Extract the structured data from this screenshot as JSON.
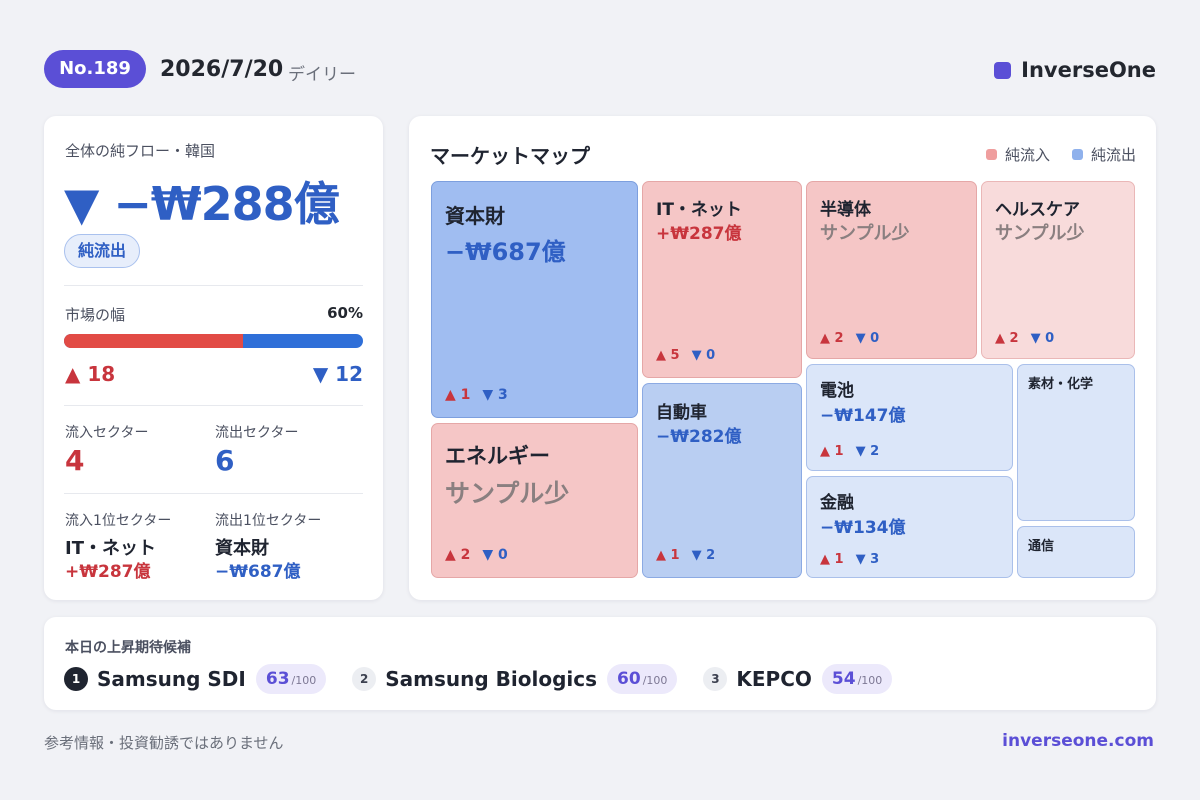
{
  "header": {
    "issue": "No.189",
    "date": "2026/7/20",
    "frequency": "デイリー",
    "brand": "InverseOne"
  },
  "colors": {
    "brand": "#5b4fd6",
    "inflow": "#f5c6c6",
    "outflow": "#a0bdf1",
    "up": "#c8353d",
    "down": "#2f5fc4"
  },
  "summary": {
    "label": "全体の純フロー・韓国",
    "total": "▼ −₩288億",
    "tag": "純流出",
    "breadth_label": "市場の幅",
    "breadth_pct": "60%",
    "breadth_up_fraction": 0.6,
    "advancers": "▲ 18",
    "decliners": "▼ 12",
    "inflow_sectors_label": "流入セクター",
    "inflow_sectors": "4",
    "outflow_sectors_label": "流出セクター",
    "outflow_sectors": "6",
    "top_inflow_label": "流入1位セクター",
    "top_inflow_name": "IT・ネット",
    "top_inflow_amount": "+₩287億",
    "top_outflow_label": "流出1位セクター",
    "top_outflow_name": "資本財",
    "top_outflow_amount": "−₩687億"
  },
  "market_map": {
    "title": "マーケットマップ",
    "legend_inflow": "純流入",
    "legend_outflow": "純流出",
    "tiles": {
      "capital_goods": {
        "name": "資本財",
        "amount": "−₩687億",
        "up": "▲ 1",
        "down": "▼ 3"
      },
      "energy": {
        "name": "エネルギー",
        "amount": "サンプル少",
        "up": "▲ 2",
        "down": "▼ 0"
      },
      "it_net": {
        "name": "IT・ネット",
        "amount": "+₩287億",
        "up": "▲ 5",
        "down": "▼ 0"
      },
      "autos": {
        "name": "自動車",
        "amount": "−₩282億",
        "up": "▲ 1",
        "down": "▼ 2"
      },
      "semis": {
        "name": "半導体",
        "amount": "サンプル少",
        "up": "▲ 2",
        "down": "▼ 0"
      },
      "healthcare": {
        "name": "ヘルスケア",
        "amount": "サンプル少",
        "up": "▲ 2",
        "down": "▼ 0"
      },
      "batteries": {
        "name": "電池",
        "amount": "−₩147億",
        "up": "▲ 1",
        "down": "▼ 2"
      },
      "financials": {
        "name": "金融",
        "amount": "−₩134億",
        "up": "▲ 1",
        "down": "▼ 3"
      },
      "materials": {
        "name": "素材・化学"
      },
      "telecom": {
        "name": "通信"
      }
    }
  },
  "candidates": {
    "title": "本日の上昇期待候補",
    "items": [
      {
        "rank": "1",
        "name": "Samsung SDI",
        "score": "63",
        "max": "/100"
      },
      {
        "rank": "2",
        "name": "Samsung Biologics",
        "score": "60",
        "max": "/100"
      },
      {
        "rank": "3",
        "name": "KEPCO",
        "score": "54",
        "max": "/100"
      }
    ]
  },
  "footer": {
    "disclaimer": "参考情報・投資勧誘ではありません",
    "url": "inverseone.com"
  }
}
